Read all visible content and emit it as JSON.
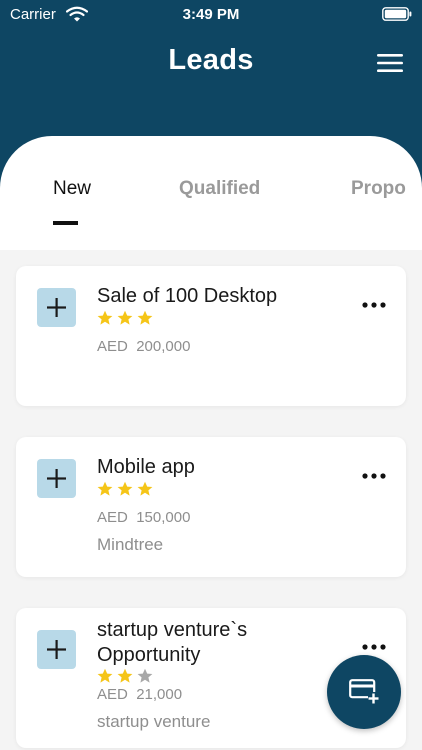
{
  "status_bar": {
    "carrier": "Carrier",
    "time": "3:49 PM"
  },
  "header": {
    "title": "Leads",
    "menu_icon": "hamburger-menu-icon"
  },
  "tabs": [
    {
      "label": "New",
      "active": true
    },
    {
      "label": "Qualified",
      "active": false
    },
    {
      "label": "Propo",
      "active": false
    }
  ],
  "leads": [
    {
      "title": "Sale of 100 Desktop",
      "rating": 3,
      "max_rating": 3,
      "currency": "AED",
      "amount": "200,000",
      "company": ""
    },
    {
      "title": "Mobile app",
      "rating": 3,
      "max_rating": 3,
      "currency": "AED",
      "amount": "150,000",
      "company": "Mindtree"
    },
    {
      "title": "startup venture`s Opportunity",
      "rating": 2,
      "max_rating": 3,
      "currency": "AED",
      "amount": "21,000",
      "company": "startup venture"
    }
  ],
  "colors": {
    "header_bg": "#0e4663",
    "star_filled": "#f5c518",
    "star_empty": "#a8a8a8",
    "add_button_bg": "#b8d9e8"
  },
  "fab": {
    "icon": "add-card-icon"
  }
}
